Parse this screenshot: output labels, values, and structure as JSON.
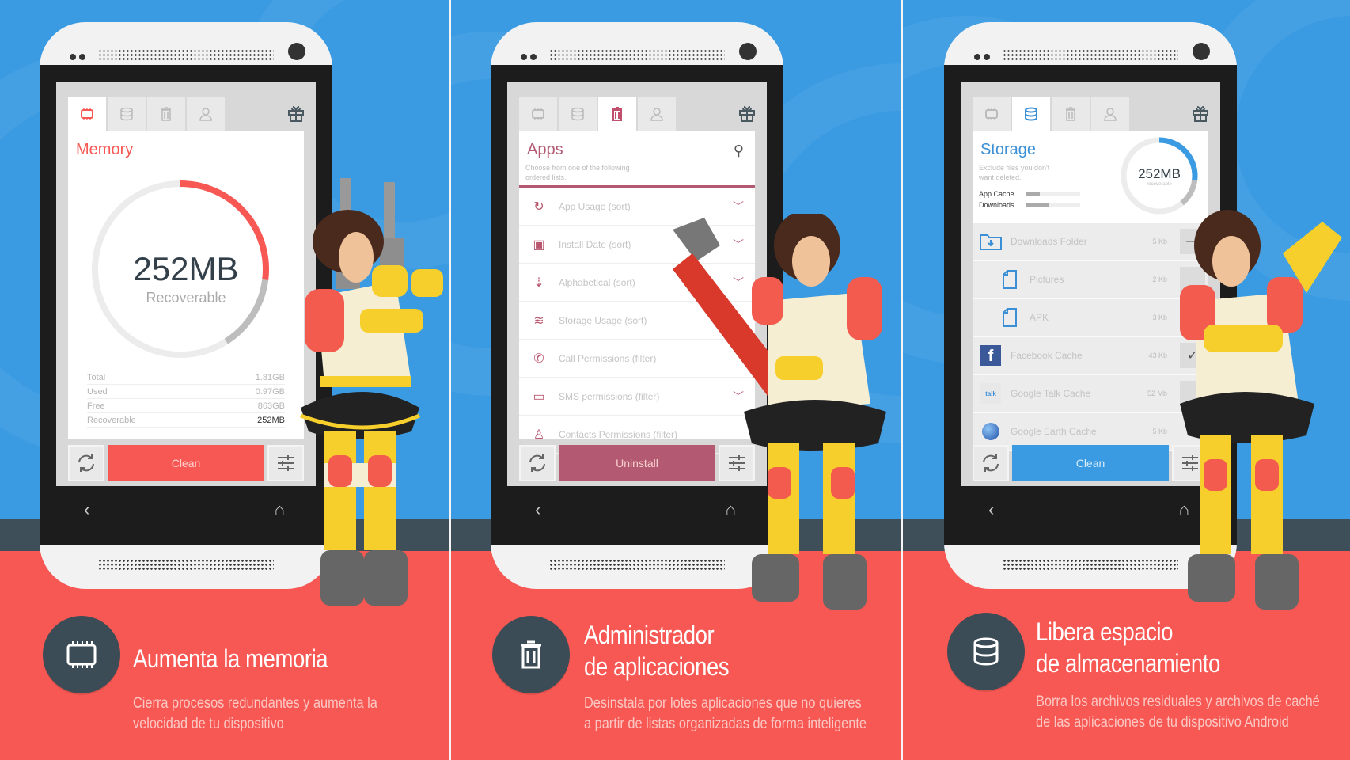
{
  "colors": {
    "blue_bg": "#3a9be2",
    "red_bg": "#f75853",
    "dark_band": "#3e4f5a",
    "memory_accent": "#f75853",
    "apps_accent": "#b35a72",
    "storage_accent": "#3a9be2"
  },
  "panels": [
    {
      "id": "memory",
      "tabs": [
        "chip-icon",
        "database-icon",
        "trash-icon",
        "person-icon"
      ],
      "active_tab": 0,
      "gift_icon": "gift-icon",
      "screen_title": "Memory",
      "gauge": {
        "value": "252MB",
        "label": "Recoverable",
        "recoverable_fraction": 0.27,
        "used_fraction": 0.14
      },
      "stats": [
        {
          "label": "Total",
          "value": "1.81GB"
        },
        {
          "label": "Used",
          "value": "0.97GB"
        },
        {
          "label": "Free",
          "value": "863GB"
        },
        {
          "label": "Recoverable",
          "value": "252MB"
        }
      ],
      "action_label": "Clean",
      "caption_icon": "chip-icon",
      "caption_title": "Aumenta la memoria",
      "caption_desc": "Cierra procesos redundantes y aumenta la velocidad de tu dispositivo"
    },
    {
      "id": "apps",
      "tabs": [
        "chip-icon",
        "database-icon",
        "trash-icon",
        "person-icon"
      ],
      "active_tab": 2,
      "gift_icon": "gift-icon",
      "screen_title": "Apps",
      "screen_subtitle": "Choose from one of the following ordered lists.",
      "list": [
        {
          "icon": "history-icon",
          "label": "App Usage (sort)"
        },
        {
          "icon": "calendar-icon",
          "label": "Install Date  (sort)"
        },
        {
          "icon": "alphabetical-icon",
          "label": "Alphabetical (sort)"
        },
        {
          "icon": "database-icon",
          "label": "Storage Usage (sort)"
        },
        {
          "icon": "phone-icon",
          "label": "Call Permissions (filter)"
        },
        {
          "icon": "sms-icon",
          "label": "SMS permissions (filter)"
        },
        {
          "icon": "person-icon",
          "label": "Contacts Permissions (filter)"
        }
      ],
      "action_label": "Uninstall",
      "caption_icon": "trash-icon",
      "caption_title_1": "Administrador",
      "caption_title_2": "de aplicaciones",
      "caption_desc": "Desinstala por lotes aplicaciones que no quieres a partir de listas organizadas de forma inteligente"
    },
    {
      "id": "storage",
      "tabs": [
        "chip-icon",
        "database-icon",
        "trash-icon",
        "person-icon"
      ],
      "active_tab": 1,
      "gift_icon": "gift-icon",
      "screen_title": "Storage",
      "screen_subtitle": "Exclude files you don't want deleted.",
      "gauge": {
        "value": "252MB",
        "label": "recoverable",
        "recoverable_fraction": 0.27,
        "used_fraction": 0.12
      },
      "bars": [
        {
          "label": "App Cache",
          "fraction": 0.25
        },
        {
          "label": "Downloads",
          "fraction": 0.42
        }
      ],
      "list": [
        {
          "icon": "folder-download-icon",
          "label": "Downloads Folder",
          "size": "5 Kb",
          "state": "partial",
          "child": false
        },
        {
          "icon": "file-icon",
          "label": "Pictures",
          "size": "2 Kb",
          "state": "unchecked",
          "child": true
        },
        {
          "icon": "file-icon",
          "label": "APK",
          "size": "3 Kb",
          "state": "checked",
          "child": true
        },
        {
          "icon": "facebook-icon",
          "label": "Facebook Cache",
          "size": "43 Kb",
          "state": "checked",
          "child": false
        },
        {
          "icon": "google-talk-icon",
          "label": "Google Talk Cache",
          "size": "52 Mb",
          "state": "unchecked",
          "child": false
        },
        {
          "icon": "google-earth-icon",
          "label": "Google Earth Cache",
          "size": "5 Kb",
          "state": "unchecked",
          "child": false
        }
      ],
      "action_label": "Clean",
      "caption_icon": "database-icon",
      "caption_title_1": "Libera espacio",
      "caption_title_2": "de almacenamiento",
      "caption_desc": "Borra los archivos residuales y archivos de caché de las aplicaciones de tu dispositivo Android"
    }
  ]
}
